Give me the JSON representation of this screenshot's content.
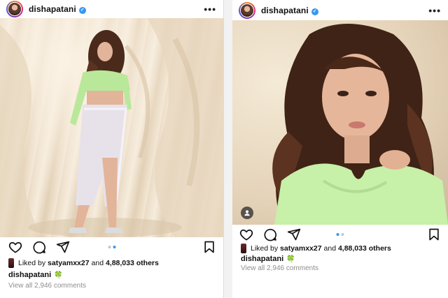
{
  "posts": [
    {
      "username": "dishapatani",
      "more_label": "•••",
      "liked_by_prefix": "Liked by ",
      "liked_by_user": "satyamxx27",
      "liked_by_and": " and ",
      "liked_by_count": "4,88,033 others",
      "caption_user": "dishapatani",
      "caption_emoji": "🍀",
      "comments_link": "View all 2,946 comments",
      "carousel": {
        "total": 2,
        "active": 1
      }
    },
    {
      "username": "dishapatani",
      "more_label": "•••",
      "liked_by_prefix": "Liked by ",
      "liked_by_user": "satyamxx27",
      "liked_by_and": " and ",
      "liked_by_count": "4,88,033 others",
      "caption_user": "dishapatani",
      "caption_emoji": "🍀",
      "comments_link": "View all 2,946 comments",
      "carousel": {
        "total": 2,
        "active": 2
      }
    }
  ],
  "icons": {
    "like": "heart-icon",
    "comment": "comment-icon",
    "share": "paper-plane-icon",
    "save": "bookmark-icon",
    "verified": "verified-badge-icon",
    "tagged": "user-tag-icon"
  },
  "colors": {
    "accent": "#3897f0",
    "muted": "#8e8e8e",
    "text": "#111111"
  }
}
